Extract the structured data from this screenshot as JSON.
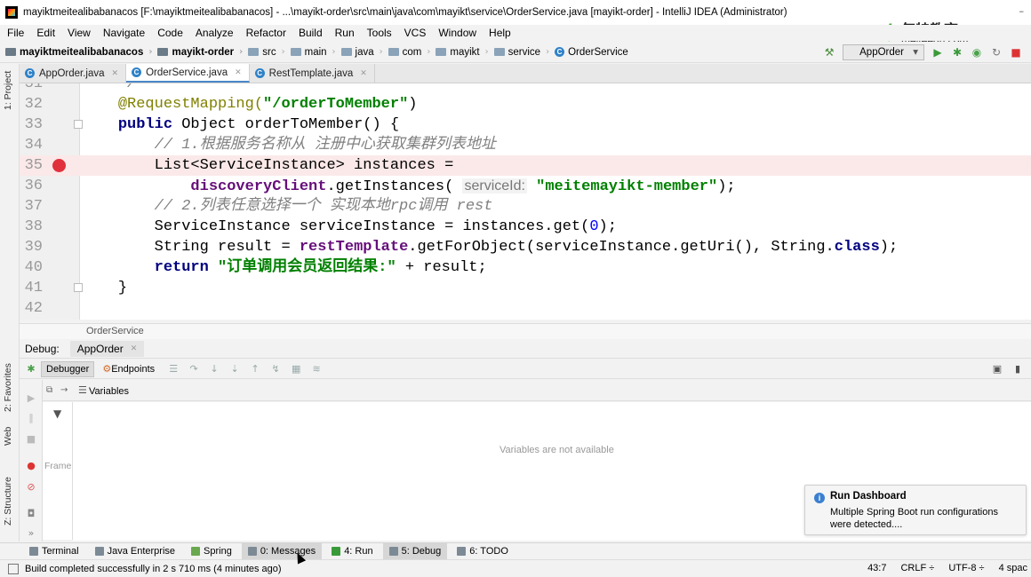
{
  "window": {
    "title": "mayiktmeitealibabanacos [F:\\mayiktmeitealibabanacos] - ...\\mayikt-order\\src\\main\\java\\com\\mayikt\\service\\OrderService.java [mayikt-order] - IntelliJ IDEA (Administrator)"
  },
  "watermark": {
    "mark": "mt",
    "cn": "每特教育",
    "en": "meiteedu.com"
  },
  "menu": [
    "File",
    "Edit",
    "View",
    "Navigate",
    "Code",
    "Analyze",
    "Refactor",
    "Build",
    "Run",
    "Tools",
    "VCS",
    "Window",
    "Help"
  ],
  "breadcrumb": [
    "mayiktmeitealibabanacos",
    "mayikt-order",
    "src",
    "main",
    "java",
    "com",
    "mayikt",
    "service",
    "OrderService"
  ],
  "run_config": "AppOrder",
  "side_tabs": {
    "project": "1: Project",
    "favorites": "2: Favorites",
    "web": "Web",
    "structure": "Z: Structure"
  },
  "tabs": [
    {
      "label": "AppOrder.java",
      "active": false
    },
    {
      "label": "OrderService.java",
      "active": true
    },
    {
      "label": "RestTemplate.java",
      "active": false
    }
  ],
  "code": {
    "l31": {
      "num": "31",
      "text": "    */"
    },
    "l32": {
      "num": "32",
      "ann": "@RequestMapping(",
      "str": "\"/orderToMember\"",
      "tail": ")"
    },
    "l33": {
      "num": "33",
      "kw": "public",
      "text": " Object orderToMember() {"
    },
    "l34": {
      "num": "34",
      "cmt": "// 1.根据服务名称从 注册中心获取集群列表地址"
    },
    "l35": {
      "num": "35",
      "text": "List<ServiceInstance> instances ="
    },
    "l36": {
      "num": "36",
      "fld": "discoveryClient",
      "text": ".getInstances(",
      "hint": "serviceId:",
      "str": "\"meitemayikt-member\"",
      "tail": ");"
    },
    "l37": {
      "num": "37",
      "cmt": "// 2.列表任意选择一个 实现本地rpc调用 rest"
    },
    "l38": {
      "num": "38",
      "text": "ServiceInstance serviceInstance = instances.get(",
      "n": "0",
      "tail": ");"
    },
    "l39": {
      "num": "39",
      "pre": "String result = ",
      "fld": "restTemplate",
      "mid": ".getForObject(serviceInstance.getUri(), String.",
      "kw": "class",
      "tail": ");"
    },
    "l40": {
      "num": "40",
      "kw": "return",
      "str": "\"订单调用会员返回结果:\"",
      "tail": " + result;"
    },
    "l41": {
      "num": "41",
      "text": "}"
    },
    "l42": {
      "num": "42",
      "text": ""
    }
  },
  "editor_crumb": "OrderService",
  "debug": {
    "label": "Debug:",
    "config": "AppOrder",
    "tab_debugger": "Debugger",
    "tab_endpoints": "Endpoints",
    "variables_label": "Variables",
    "frames_label": "Frame",
    "empty_message": "Variables are not available"
  },
  "popup": {
    "title": "Run Dashboard",
    "body": "Multiple Spring Boot run configurations were detected...."
  },
  "bottom_tabs": [
    {
      "label": "Terminal",
      "active": false
    },
    {
      "label": "Java Enterprise",
      "active": false
    },
    {
      "label": "Spring",
      "active": false
    },
    {
      "label": "0: Messages",
      "active": true
    },
    {
      "label": "4: Run",
      "active": false
    },
    {
      "label": "5: Debug",
      "active": true
    },
    {
      "label": "6: TODO",
      "active": false
    }
  ],
  "status": {
    "message": "Build completed successfully in 2 s 710 ms (4 minutes ago)",
    "position": "43:7",
    "line_sep": "CRLF ÷",
    "encoding": "UTF-8 ÷",
    "indent": "4 spac"
  },
  "colors": {
    "breakpoint": "#e0303b",
    "keyword": "#000080",
    "string": "#008000",
    "annotation": "#808000",
    "comment": "#808080",
    "field": "#660e7a"
  }
}
